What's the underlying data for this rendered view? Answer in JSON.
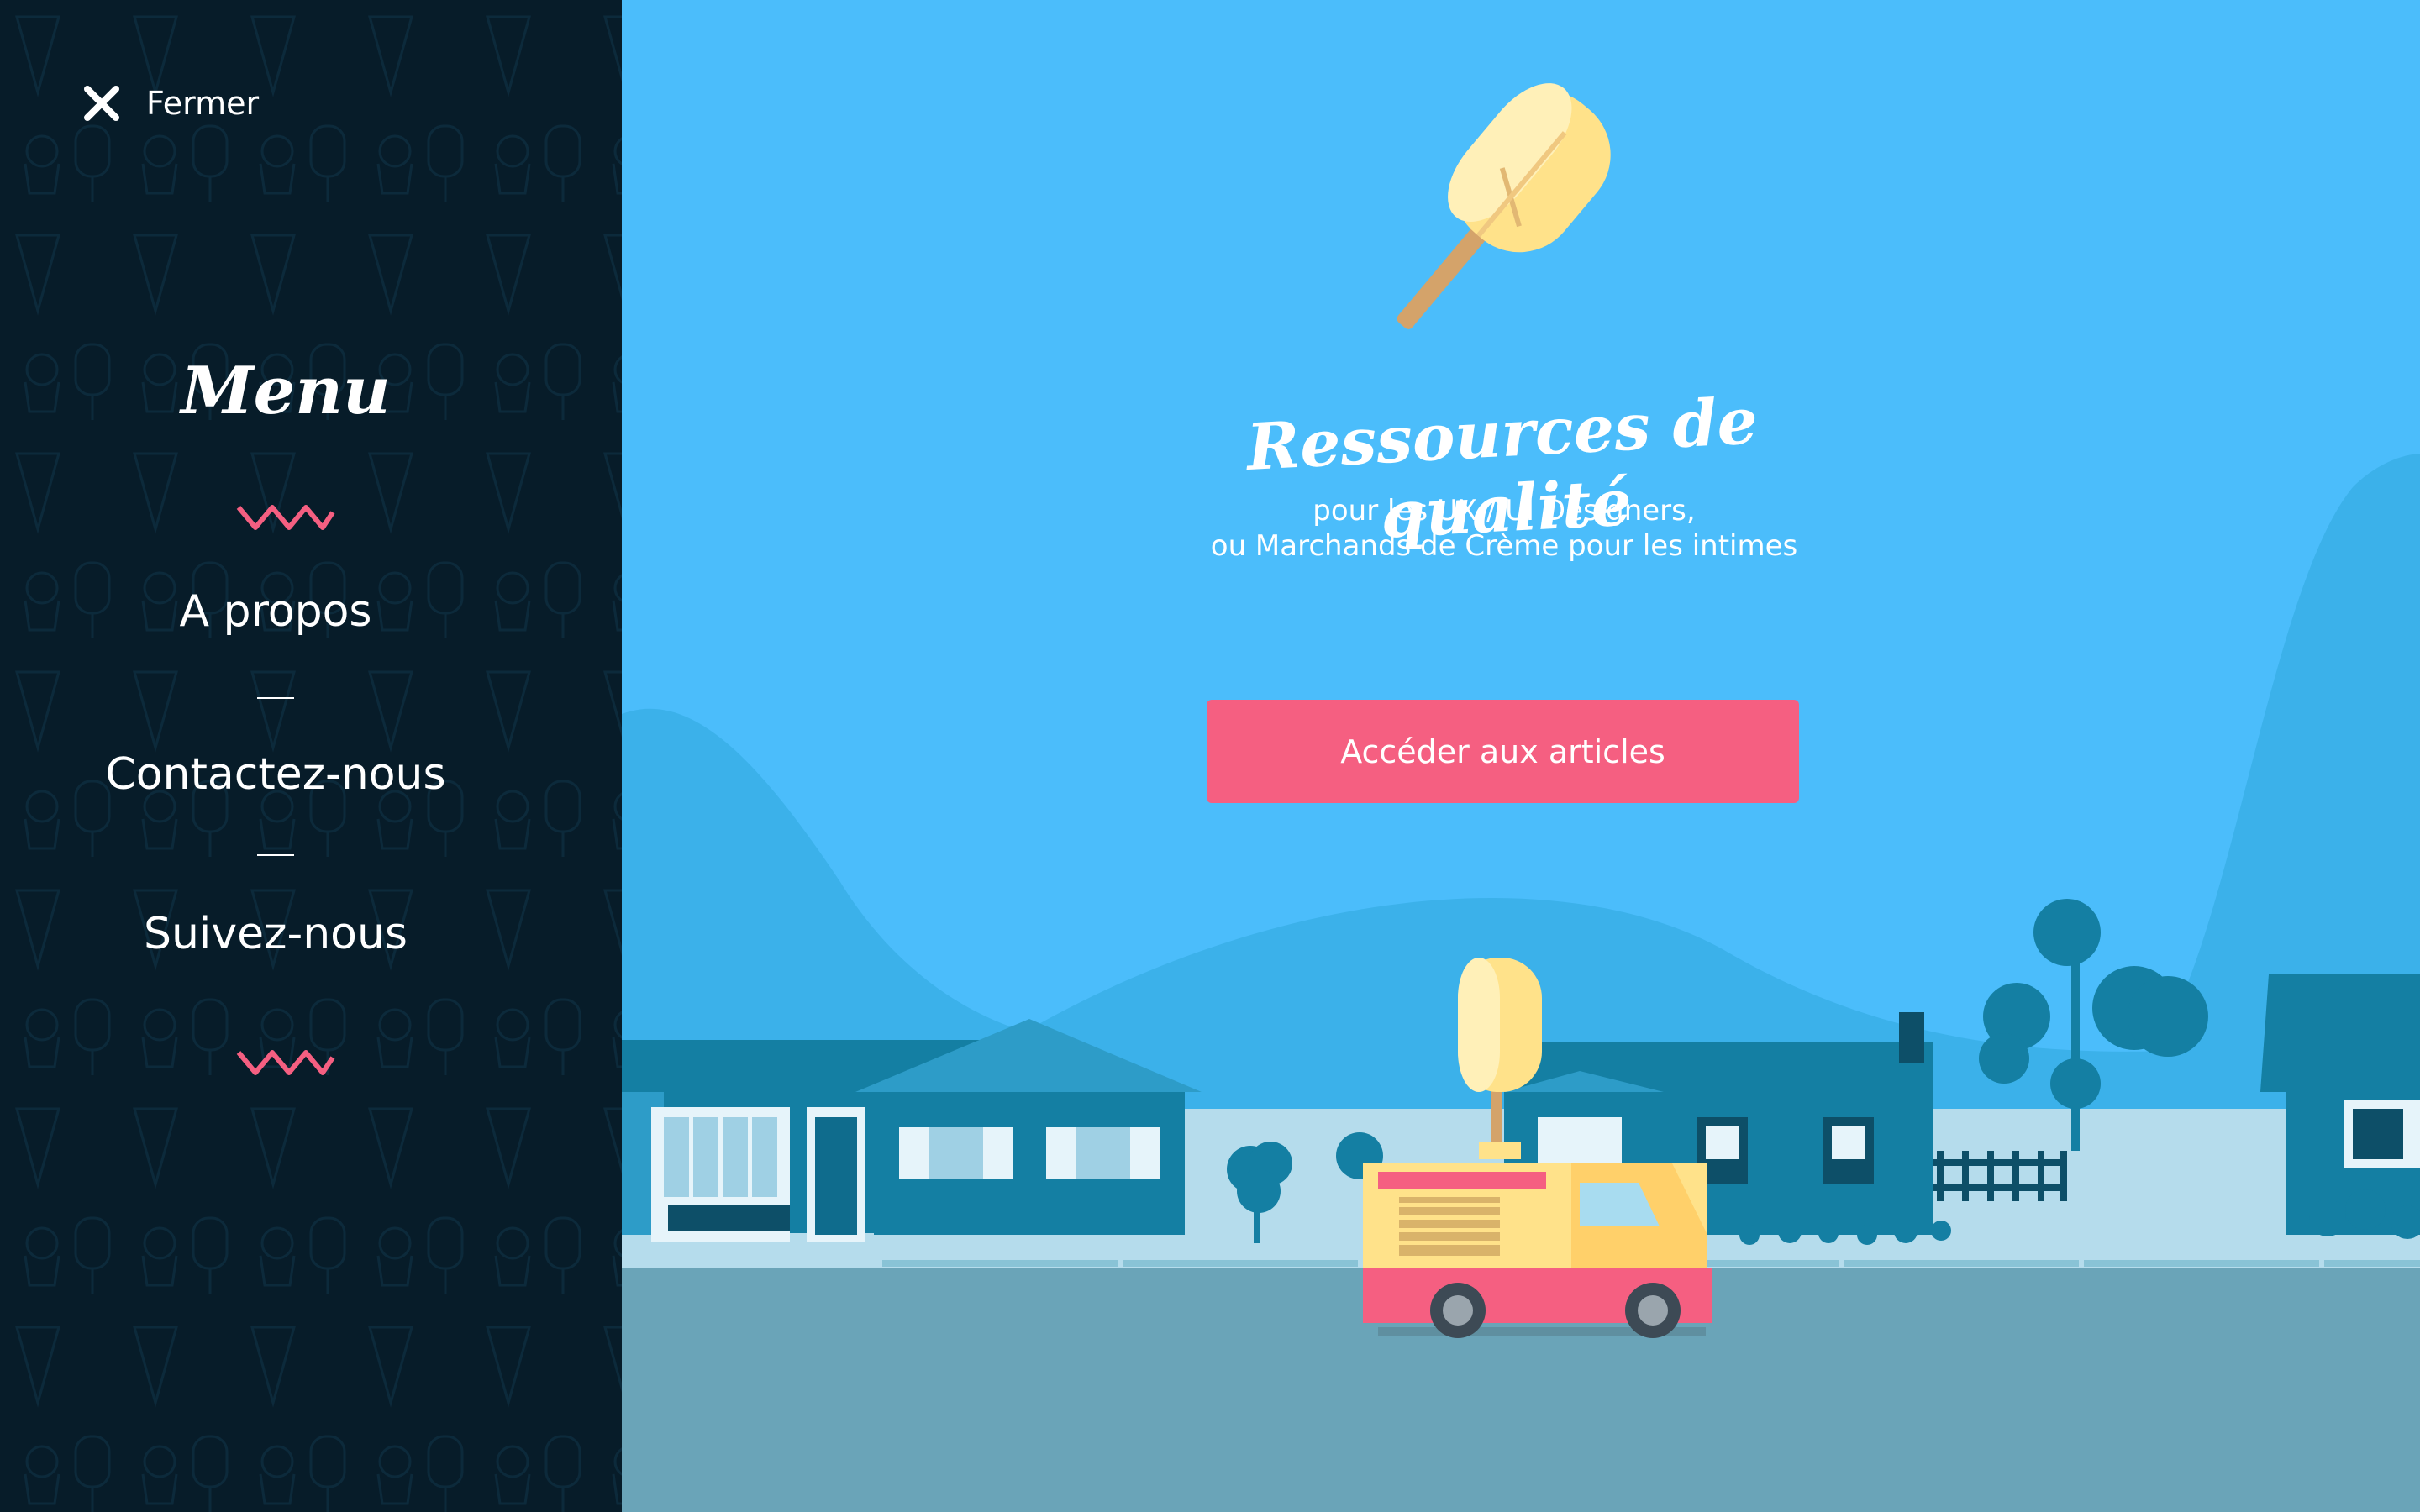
{
  "sidebar": {
    "close_label": "Fermer",
    "title": "Menu",
    "items": [
      {
        "label": "A propos"
      },
      {
        "label": "Contactez-nous"
      },
      {
        "label": "Suivez-nous"
      }
    ]
  },
  "hero": {
    "title": "Ressources de qualité",
    "subtitle_line1": "pour les UX / UI Designers,",
    "subtitle_line2": "ou Marchands de Crème pour les intimes",
    "cta_label": "Accéder aux articles"
  },
  "colors": {
    "sidebar_bg": "#071c29",
    "sky": "#4bbdfb",
    "accent_pink": "#f55f81",
    "road": "#6aa4b8",
    "houses": "#147fa3"
  },
  "icons": {
    "close": "close-icon",
    "zigzag": "zigzag-icon",
    "popsicle": "popsicle-icon",
    "ice_cream_truck": "ice-cream-truck-icon"
  }
}
